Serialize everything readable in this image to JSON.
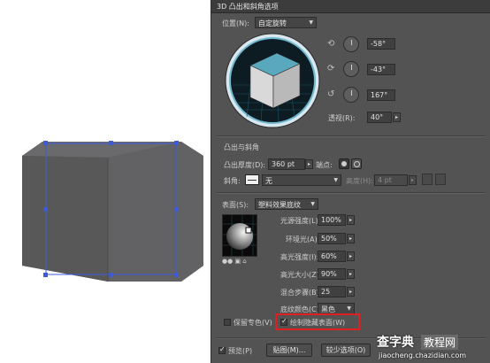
{
  "dialog": {
    "title": "3D 凸出和斜角选项",
    "position": {
      "label": "位置(N):",
      "value": "自定旋转"
    },
    "rotations": [
      {
        "value": "-58°",
        "icon": "x-axis-rotate-icon"
      },
      {
        "value": "-43°",
        "icon": "y-axis-rotate-icon"
      },
      {
        "value": "167°",
        "icon": "z-axis-rotate-icon"
      }
    ],
    "perspective": {
      "label": "透视(R):",
      "value": "40°"
    },
    "extrude_section": {
      "title": "凸出与斜角",
      "depth_label": "凸出厚度(D):",
      "depth_value": "360 pt",
      "cap_label": "端点:",
      "bevel_label": "斜角:",
      "bevel_value": "无",
      "height_label": "高度(H):",
      "height_value": "4 pt"
    },
    "surface": {
      "label": "表面(S):",
      "value": "塑料效果底纹",
      "light_intensity_label": "光源强度(L):",
      "light_intensity_value": "100%",
      "ambient_label": "环境光(A):",
      "ambient_value": "50%",
      "highlight_intensity_label": "高光强度(I):",
      "highlight_intensity_value": "60%",
      "highlight_size_label": "高光大小(Z):",
      "highlight_size_value": "90%",
      "blend_steps_label": "混合步骤(B):",
      "blend_steps_value": "25",
      "shading_color_label": "底纹颜色(C):",
      "shading_color_value": "黑色"
    },
    "preserve_spot_label": "保留专色(V)",
    "draw_hidden_label": "绘制隐藏表面(W)",
    "preview_label": "预览(P)",
    "map_art_label": "贴图(M)...",
    "fewer_options_label": "较少选项(O)"
  },
  "watermark": {
    "brand": "查字典",
    "sub": "教程网",
    "url": "jiaocheng.chazidian.com"
  },
  "colors": {
    "highlight_box": "#e02020",
    "cube_top": "#5aa8be",
    "selection": "#3b5bdb"
  }
}
